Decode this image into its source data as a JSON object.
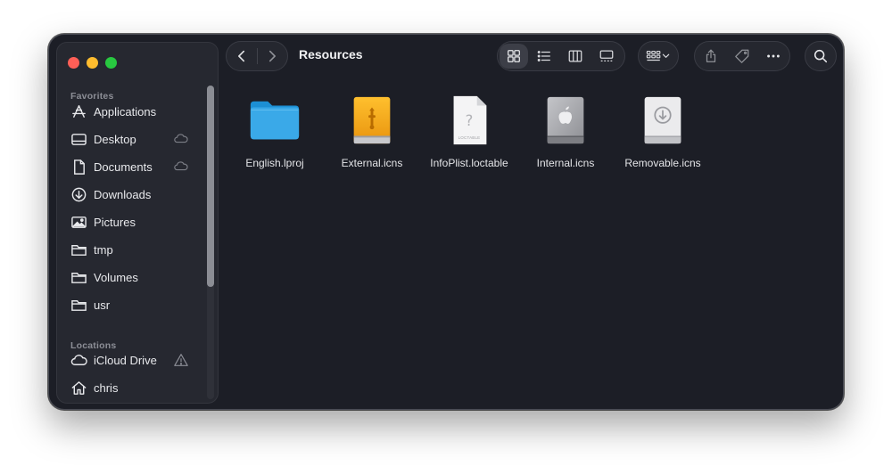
{
  "window": {
    "title": "Resources"
  },
  "sidebar": {
    "favorites_header": "Favorites",
    "favorites": [
      {
        "label": "Applications",
        "icon": "applications-icon"
      },
      {
        "label": "Desktop",
        "icon": "desktop-icon",
        "cloud": true
      },
      {
        "label": "Documents",
        "icon": "document-icon",
        "cloud": true
      },
      {
        "label": "Downloads",
        "icon": "downloads-icon"
      },
      {
        "label": "Pictures",
        "icon": "pictures-icon"
      },
      {
        "label": "tmp",
        "icon": "folder-icon"
      },
      {
        "label": "Volumes",
        "icon": "folder-icon"
      },
      {
        "label": "usr",
        "icon": "folder-icon"
      }
    ],
    "locations_header": "Locations",
    "locations": [
      {
        "label": "iCloud Drive",
        "icon": "cloud-icon",
        "warning": true
      },
      {
        "label": "chris",
        "icon": "home-icon"
      }
    ]
  },
  "files": [
    {
      "name": "English.lproj",
      "icon": "folder-icon"
    },
    {
      "name": "External.icns",
      "icon": "external-drive-icon"
    },
    {
      "name": "InfoPlist.loctable",
      "icon": "loctable-file-icon",
      "icon_caption": "LOCTABLE"
    },
    {
      "name": "Internal.icns",
      "icon": "internal-drive-icon"
    },
    {
      "name": "Removable.icns",
      "icon": "removable-drive-icon"
    }
  ],
  "colors": {
    "folder_blue": "#3aa9e8",
    "external_orange": "#f5a623",
    "window_bg": "#1c1e26",
    "sidebar_bg": "#262830"
  }
}
